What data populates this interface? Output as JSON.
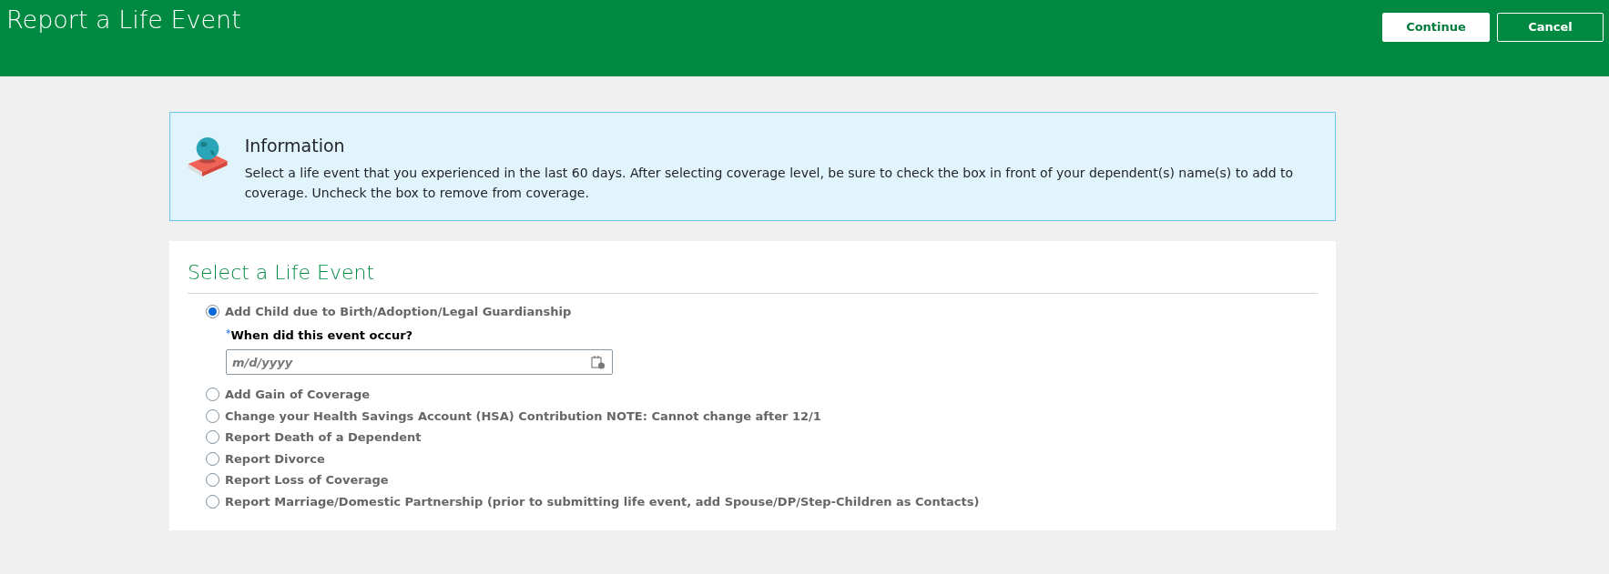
{
  "header": {
    "title": "Report a Life Event",
    "buttons": [
      {
        "label": "Continue",
        "kind": "primary"
      },
      {
        "label": "Cancel",
        "kind": "outline"
      }
    ]
  },
  "information": {
    "title": "Information",
    "message": "Select a life event that you experienced in the last 60 days. After selecting coverage level, be sure to check the box in front of your dependent(s) name(s) to add to coverage. Uncheck the box to remove from coverage."
  },
  "life_events": {
    "title": "Select a Life Event",
    "options": [
      {
        "label": "Add Child due to Birth/Adoption/Legal Guardianship",
        "selected": true,
        "date_field": {
          "label": "When did this event occur?",
          "required_marker": "*",
          "placeholder": "m/d/yyyy"
        }
      },
      {
        "label": "Add Gain of Coverage",
        "selected": false
      },
      {
        "label": "Change your Health Savings Account (HSA) Contribution NOTE: Cannot change after 12/1",
        "selected": false
      },
      {
        "label": "Report Death of a Dependent",
        "selected": false
      },
      {
        "label": "Report Divorce",
        "selected": false
      },
      {
        "label": "Report Loss of Coverage",
        "selected": false
      },
      {
        "label": "Report Marriage/Domestic Partnership (prior to submitting life event, add Spouse/DP/Step-Children as Contacts)",
        "selected": false
      }
    ]
  }
}
